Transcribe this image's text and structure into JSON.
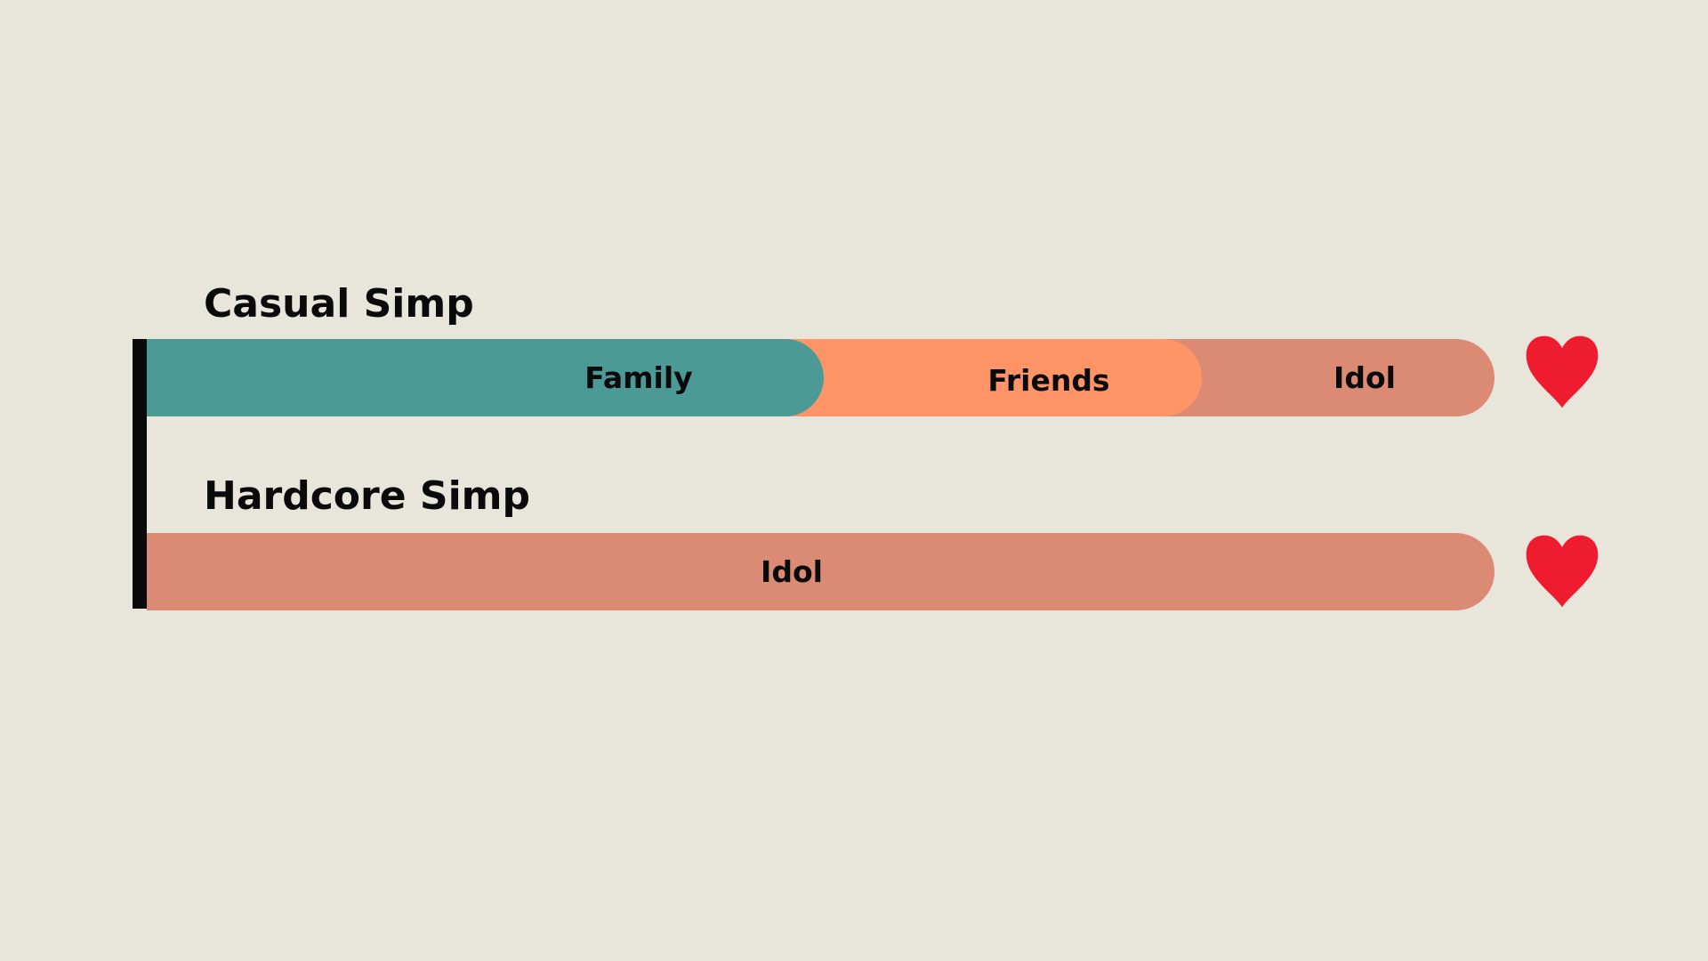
{
  "colors": {
    "background": "#e8e6db",
    "family": "#4c9a95",
    "friends": "#ff9466",
    "idol": "#db8a74",
    "heart": "#ee1c2e"
  },
  "rows": [
    {
      "title": "Casual Simp",
      "segments": [
        {
          "label": "Family"
        },
        {
          "label": "Friends"
        },
        {
          "label": "Idol"
        }
      ]
    },
    {
      "title": "Hardcore Simp",
      "segments": [
        {
          "label": "Idol"
        }
      ]
    }
  ],
  "icons": {
    "end": "heart-icon"
  }
}
